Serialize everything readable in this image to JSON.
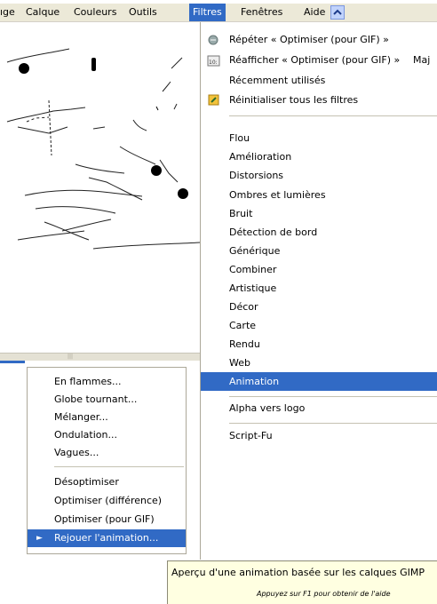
{
  "menubar": {
    "items": [
      {
        "label": "ıge"
      },
      {
        "label": "Calque"
      },
      {
        "label": "Couleurs"
      },
      {
        "label": "Outils"
      },
      {
        "label": "Filtres"
      },
      {
        "label": "Fenêtres"
      },
      {
        "label": "Aide"
      }
    ],
    "scroll_icon": "chevron-up-icon"
  },
  "filters_menu": {
    "items": [
      {
        "label": "Répéter « Optimiser (pour GIF) »",
        "icon": "repeat-icon"
      },
      {
        "label": "Réafficher « Optimiser (pour GIF) »",
        "icon": "reshow-icon",
        "shortcut": "Maj"
      },
      {
        "label": "Récemment utilisés"
      },
      {
        "label": "Réinitialiser tous les filtres",
        "icon": "reset-icon"
      },
      {
        "label": "Flou"
      },
      {
        "label": "Amélioration"
      },
      {
        "label": "Distorsions"
      },
      {
        "label": "Ombres et lumières"
      },
      {
        "label": "Bruit"
      },
      {
        "label": "Détection de bord"
      },
      {
        "label": "Générique"
      },
      {
        "label": "Combiner"
      },
      {
        "label": "Artistique"
      },
      {
        "label": "Décor"
      },
      {
        "label": "Carte"
      },
      {
        "label": "Rendu"
      },
      {
        "label": "Web"
      },
      {
        "label": "Animation"
      },
      {
        "label": "Alpha vers logo"
      },
      {
        "label": "Script-Fu"
      }
    ]
  },
  "animation_submenu": {
    "items": [
      {
        "label": "En flammes..."
      },
      {
        "label": "Globe tournant..."
      },
      {
        "label": "Mélanger..."
      },
      {
        "label": "Ondulation..."
      },
      {
        "label": "Vagues..."
      },
      {
        "label": "Désoptimiser"
      },
      {
        "label": "Optimiser (différence)"
      },
      {
        "label": "Optimiser (pour GIF)"
      },
      {
        "label": "Rejouer l'animation..."
      }
    ],
    "arrow": "►"
  },
  "tooltip": {
    "text": "Aperçu d'une animation basée sur les calques GIMP",
    "hint": "Appuyez sur F1 pour obtenir de l'aide"
  },
  "colors": {
    "highlight": "#316ac5",
    "menubar_bg": "#ece9d8",
    "tooltip_bg": "#ffffe1"
  }
}
